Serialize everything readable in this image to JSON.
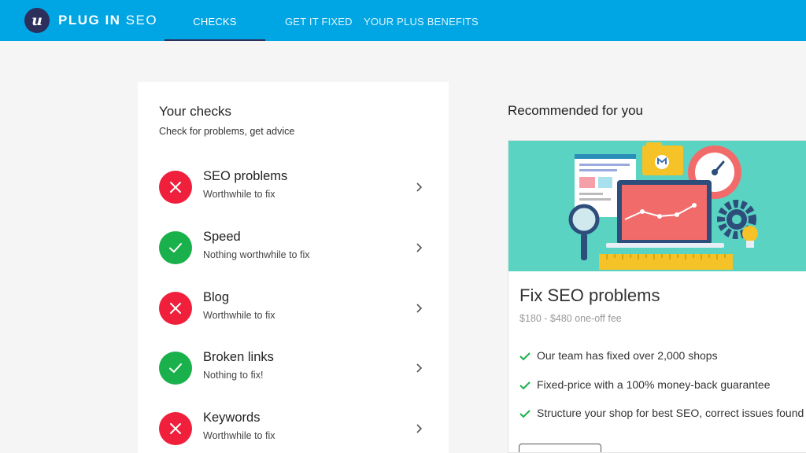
{
  "brand": {
    "logo_letter": "u",
    "name_bold": "PLUG IN",
    "name_light": "SEO"
  },
  "nav": {
    "tabs": [
      {
        "label": "CHECKS",
        "active": true
      },
      {
        "label": "GET IT FIXED",
        "active": false
      },
      {
        "label": "YOUR PLUS BENEFITS",
        "active": false
      }
    ]
  },
  "checks": {
    "title": "Your checks",
    "subtitle": "Check for problems, get advice",
    "items": [
      {
        "title": "SEO problems",
        "subtitle": "Worthwhile to fix",
        "status": "bad"
      },
      {
        "title": "Speed",
        "subtitle": "Nothing worthwhile to fix",
        "status": "good"
      },
      {
        "title": "Blog",
        "subtitle": "Worthwhile to fix",
        "status": "bad"
      },
      {
        "title": "Broken links",
        "subtitle": "Nothing to fix!",
        "status": "good"
      },
      {
        "title": "Keywords",
        "subtitle": "Worthwhile to fix",
        "status": "bad"
      }
    ]
  },
  "recommended": {
    "heading": "Recommended for you",
    "offer": {
      "title": "Fix SEO problems",
      "price": "$180 - $480 one-off fee",
      "benefits": [
        "Our team has fixed over 2,000 shops",
        "Fixed-price with a 100% money-back guarantee",
        "Structure your shop for best SEO, correct issues found"
      ]
    }
  },
  "colors": {
    "topbar": "#00a5e3",
    "brand_dark": "#2c2e5c",
    "status_bad": "#f0203c",
    "status_good": "#1ab04b",
    "hero_bg": "#5ad3c3",
    "benefit_check": "#1ab04b"
  },
  "icons": {
    "status_bad": "close-icon",
    "status_good": "checkmark-icon",
    "row_action": "chevron-right-icon",
    "benefit": "check-icon"
  }
}
